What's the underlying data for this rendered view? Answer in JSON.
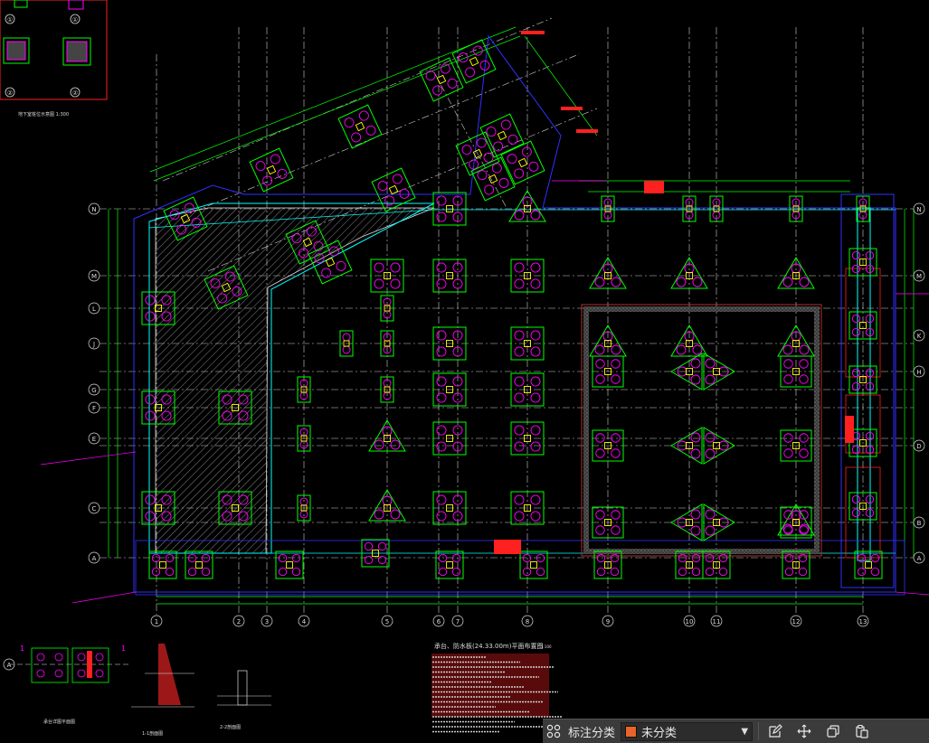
{
  "drawing": {
    "legend_numbers": [
      "①",
      "①",
      "②",
      "②"
    ],
    "legend_caption": "地下室桩位示意图 1:300",
    "grid_top": [
      "N",
      "M",
      "L",
      "J",
      "G",
      "F",
      "E",
      "C",
      "A"
    ],
    "grid_right": [
      "N",
      "M",
      "K",
      "H",
      "D",
      "B",
      "A"
    ],
    "grid_bottom": [
      "1",
      "2",
      "3",
      "4",
      "5",
      "6",
      "7",
      "8",
      "9",
      "10",
      "11",
      "12",
      "13"
    ],
    "bottom_section_labels": [
      "1",
      "1",
      "A"
    ],
    "section_11_caption": "1-1剖面图",
    "section_22_caption": "2-2剖面图",
    "detail_caption": "承台详图平面图",
    "main_title": "承台、防水板(24.33.00m)平面布置图",
    "main_title_scale": "1:100",
    "colors": {
      "grid": "#d8d8d8",
      "pile_cap": "#00ff00",
      "pile": "#ff00ff",
      "outline": "#3030ff",
      "hatch": "#c8c8c8",
      "dims": "#00ff00",
      "annot_red": "#ff2020",
      "annot_magenta": "#ff00ff",
      "cyan": "#00ffff",
      "yellow": "#ffff00"
    }
  },
  "toolbar": {
    "label": "标注分类",
    "selected_category": "未分类",
    "selected_color": "#e8642a",
    "icons": [
      "grid-icon",
      "edit-icon",
      "move-icon",
      "copy-icon",
      "paste-icon"
    ]
  }
}
